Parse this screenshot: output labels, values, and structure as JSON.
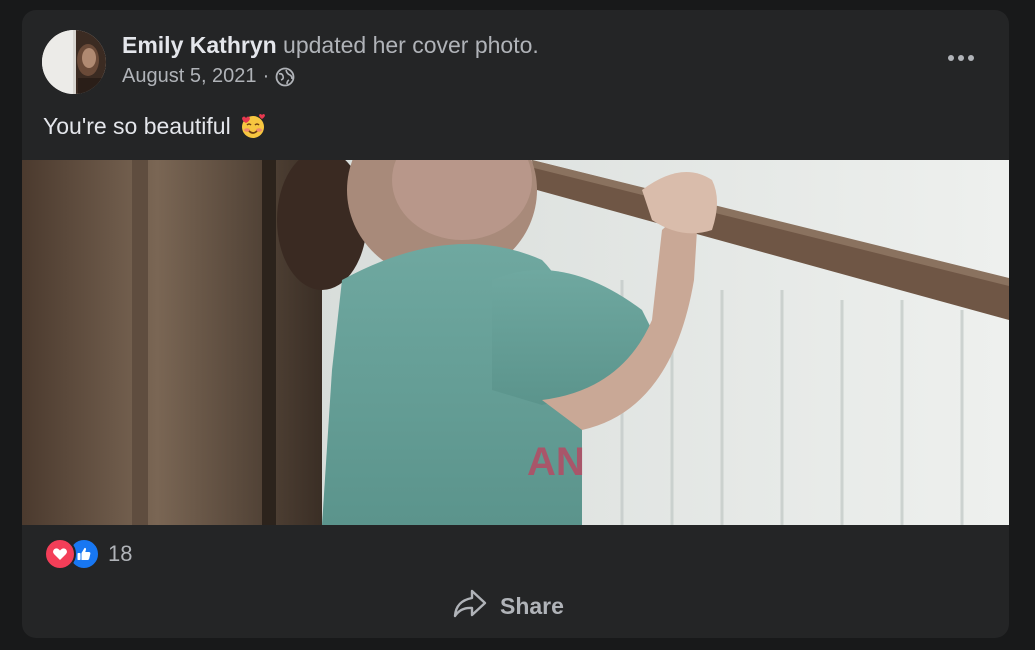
{
  "post": {
    "author_name": "Emily Kathryn",
    "action_text": " updated her cover photo.",
    "date": "August 5, 2021",
    "separator": "·",
    "audience_icon": "globe-icon",
    "menu_icon": "more-options-icon",
    "text": "You're so beautiful",
    "text_emoji": "smiling-face-with-hearts-icon",
    "photo_caption_visible": "AN"
  },
  "reactions": {
    "icons": [
      "love-icon",
      "like-icon"
    ],
    "count": "18"
  },
  "actions": {
    "share_label": "Share",
    "share_icon": "share-arrow-icon"
  },
  "colors": {
    "card_bg": "#242526",
    "page_bg": "#18191a",
    "primary_text": "#e4e6eb",
    "secondary_text": "#b0b3b8",
    "love": "#f33e58",
    "like": "#1877f2"
  }
}
